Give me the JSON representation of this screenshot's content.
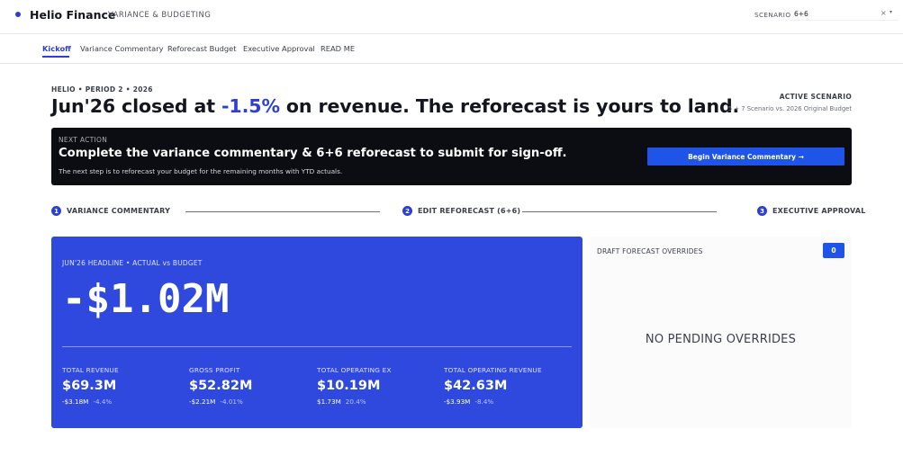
{
  "header": {
    "app_name": "Helio Finance",
    "app_subtitle": "VARIANCE & BUDGETING",
    "scenario_label": "SCENARIO",
    "scenario_value": "6+6",
    "scenario_clear": "×",
    "scenario_caret": "▾"
  },
  "tabs": [
    {
      "label": "Kickoff",
      "active": true
    },
    {
      "label": "Variance Commentary",
      "active": false
    },
    {
      "label": "Reforecast Budget",
      "active": false
    },
    {
      "label": "Executive Approval",
      "active": false
    },
    {
      "label": "READ ME",
      "active": false
    }
  ],
  "hero": {
    "eyebrow": "HELIO • PERIOD 2 • 2026",
    "headline_prefix": "Jun'26 closed at ",
    "headline_pct": "-1.5%",
    "headline_suffix": " on revenue. The reforecast is yours to land.",
    "active_scenario_title": "ACTIVE SCENARIO",
    "active_scenario_sub": "5 + 7 Scenario vs. 2026 Original Budget"
  },
  "next_action": {
    "eyebrow": "NEXT ACTION",
    "title": "Complete the variance commentary & 6+6 reforecast to submit for sign-off.",
    "description": "The next step is to reforecast your budget for the remaining months with YTD actuals.",
    "button_label": "Begin Variance Commentary →"
  },
  "steps": [
    {
      "num": "1",
      "label": "VARIANCE COMMENTARY"
    },
    {
      "num": "2",
      "label": "EDIT REFORECAST (6+6)"
    },
    {
      "num": "3",
      "label": "EXECUTIVE APPROVAL"
    }
  ],
  "kpi": {
    "eyebrow": "JUN'26 HEADLINE  •  ACTUAL vs BUDGET",
    "big_value": "-$1.02M",
    "metrics": [
      {
        "label": "TOTAL REVENUE",
        "value": "$69.3M",
        "delta_abs": "-$3.18M",
        "delta_pct": "-4.4%"
      },
      {
        "label": "GROSS PROFIT",
        "value": "$52.82M",
        "delta_abs": "-$2.21M",
        "delta_pct": "-4.01%"
      },
      {
        "label": "TOTAL OPERATING EX",
        "value": "$10.19M",
        "delta_abs": "$1.73M",
        "delta_pct": "20.4%"
      },
      {
        "label": "TOTAL OPERATING REVENUE",
        "value": "$42.63M",
        "delta_abs": "-$3.93M",
        "delta_pct": "-8.4%"
      }
    ]
  },
  "overrides": {
    "title": "DRAFT FORECAST OVERRIDES",
    "count": "0",
    "empty_text": "NO PENDING OVERRIDES"
  },
  "colors": {
    "accent": "#2b3fd6",
    "card": "#2f48dd",
    "button": "#1f54e8",
    "dark_banner": "#0b0d12"
  }
}
